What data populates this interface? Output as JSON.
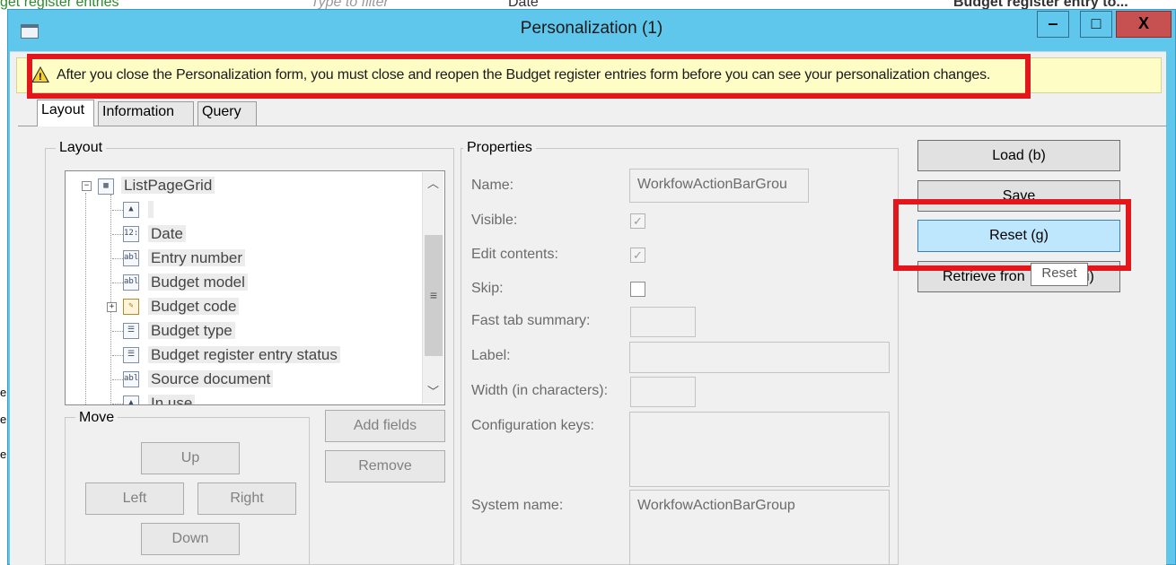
{
  "background": {
    "fragments": [
      "get register entries",
      "Type to filter",
      "Date",
      "Budget register entry to..."
    ],
    "left_edge": [
      "e",
      "e",
      "e"
    ]
  },
  "window": {
    "title": "Personalization (1)",
    "buttons": {
      "minimize": "‒",
      "maximize": "□",
      "close": "X"
    }
  },
  "infobar": {
    "message": "After you close the Personalization form, you must close and reopen the Budget register entries form before you can see your personalization changes."
  },
  "tabs": [
    "Layout",
    "Information",
    "Query"
  ],
  "layout": {
    "group_label": "Layout",
    "tree": [
      {
        "label": "ListPageGrid",
        "icon": "grid-icon"
      },
      {
        "label": "",
        "icon": "image-icon"
      },
      {
        "label": "Date",
        "icon": "date-field-icon",
        "glyph": "12:"
      },
      {
        "label": "Entry number",
        "icon": "string-field-icon",
        "glyph": "abl"
      },
      {
        "label": "Budget model",
        "icon": "string-field-icon",
        "glyph": "abl"
      },
      {
        "label": "Budget code",
        "icon": "group-field-icon"
      },
      {
        "label": "Budget type",
        "icon": "combobox-field-icon"
      },
      {
        "label": "Budget register entry status",
        "icon": "combobox-field-icon"
      },
      {
        "label": "Source document",
        "icon": "string-field-icon",
        "glyph": "abl"
      },
      {
        "label": "In use",
        "icon": "image-icon"
      }
    ],
    "buttons": {
      "add_fields": "Add fields",
      "remove": "Remove"
    },
    "move": {
      "label": "Move",
      "up": "Up",
      "left": "Left",
      "right": "Right",
      "down": "Down"
    }
  },
  "properties": {
    "label": "Properties",
    "name_label": "Name:",
    "name_value": "WorkfowActionBarGrou",
    "visible_label": "Visible:",
    "edit_contents_label": "Edit contents:",
    "skip_label": "Skip:",
    "fast_tab_label": "Fast tab summary:",
    "label_label": "Label:",
    "width_label": "Width (in characters):",
    "config_keys_label": "Configuration keys:",
    "system_name_label": "System name:",
    "system_name_value": "WorkfowActionBarGroup",
    "checks": {
      "visible": "✓",
      "edit_contents": "✓",
      "skip": ""
    }
  },
  "actions": {
    "load": "Load (b)",
    "save": "Save",
    "reset": "Reset (g)",
    "retrieve": "Retrieve fron",
    "retrieve_tail": "i)",
    "tooltip": "Reset"
  },
  "colors": {
    "title_bar": "#5fc6ec",
    "highlight": "#e3161b",
    "info_bar": "#fefdc6",
    "selected_button": "#bee6fd"
  }
}
